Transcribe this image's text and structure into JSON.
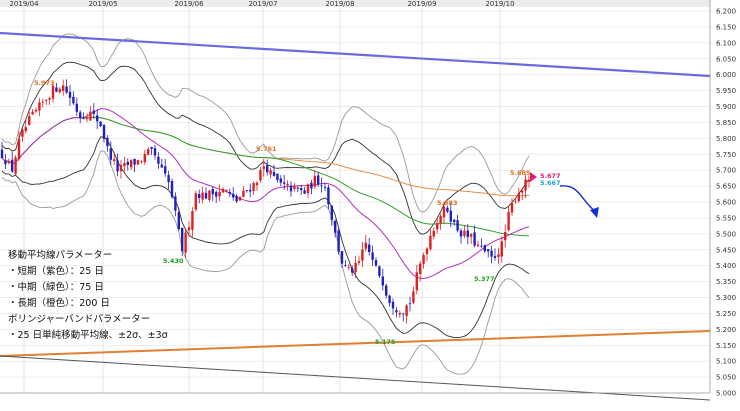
{
  "chart_data": {
    "type": "candlestick",
    "x_range": [
      "2019-04",
      "2019-10"
    ],
    "ylim": [
      5.0,
      6.2
    ],
    "y_ticks": [
      "6.200",
      "6.150",
      "6.100",
      "6.050",
      "6.000",
      "5.950",
      "5.900",
      "5.850",
      "5.800",
      "5.750",
      "5.700",
      "5.650",
      "5.600",
      "5.550",
      "5.500",
      "5.450",
      "5.400",
      "5.350",
      "5.300",
      "5.250",
      "5.200",
      "5.150",
      "5.100",
      "5.050",
      "5.000"
    ],
    "x_ticks": [
      "2019/04",
      "2019/05",
      "2019/06",
      "2019/07",
      "2019/08",
      "2019/09",
      "2019/10"
    ],
    "grid": true,
    "colors": {
      "up_candle": "#e02020",
      "down_candle": "#2020c0",
      "ma25": "#b030c0",
      "ma75": "#30a030",
      "ma200": "#e09050",
      "bollinger": "#333333",
      "resistance_trendline": "#6a6ae0",
      "support_trendline": "#e08030",
      "lower_trendline": "#555555",
      "forecast_arrow": "#1030d0",
      "last_price": "#e0206a",
      "ma_value_label": "#20a0d0",
      "high_label": "#e07020",
      "low_label": "#20a020"
    },
    "annotations": [
      {
        "text": "5.973",
        "kind": "high"
      },
      {
        "text": "5.430",
        "kind": "low"
      },
      {
        "text": "5.761",
        "kind": "high"
      },
      {
        "text": "5.175",
        "kind": "low"
      },
      {
        "text": "5.583",
        "kind": "high"
      },
      {
        "text": "5.377",
        "kind": "low"
      },
      {
        "text": "5.685",
        "kind": "high"
      },
      {
        "text": "5.677",
        "kind": "last"
      },
      {
        "text": "5.667",
        "kind": "ma"
      }
    ],
    "legend_text": [
      "移動平均線パラメーター",
      "・短期（紫色）：25 日",
      "・中期（緑色）：75 日",
      "・長期（橙色）：200 日",
      "ボリンジャーバンドパラメーター",
      "・25 日単純移動平均線、±2σ、±3σ"
    ]
  }
}
